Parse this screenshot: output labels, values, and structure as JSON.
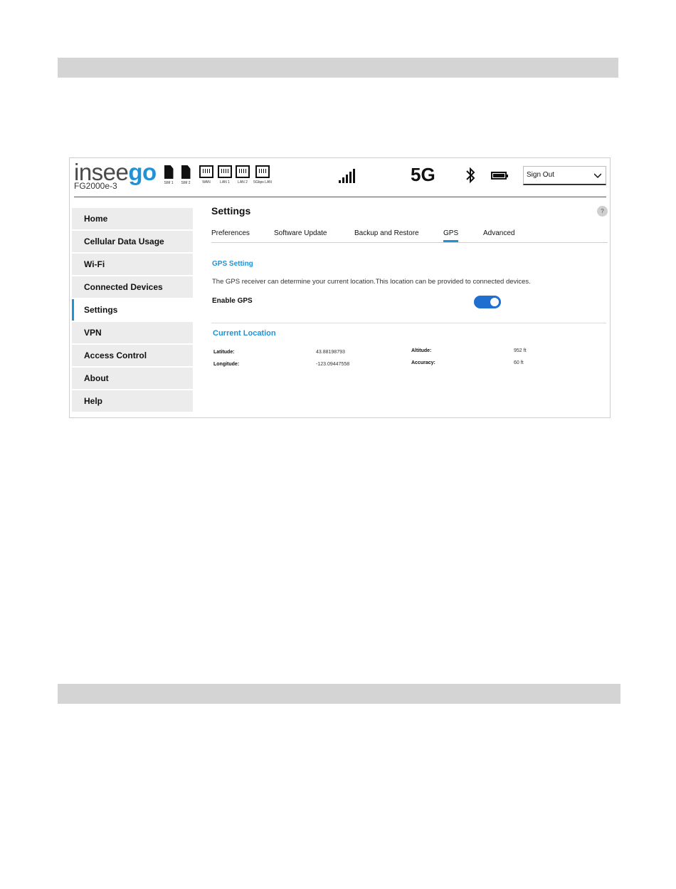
{
  "header": {
    "brand_part1": "insee",
    "brand_part2": "go",
    "model": "FG2000e-3",
    "sims": [
      {
        "label": "SIM 1"
      },
      {
        "label": "SIM 2"
      }
    ],
    "ports": [
      {
        "label": "WAN"
      },
      {
        "label": "LAN 1"
      },
      {
        "label": "LAN 2"
      },
      {
        "label": "5Gbps LAN"
      }
    ],
    "network": "5G",
    "signal_bars": 5,
    "signout_label": "Sign Out",
    "icons": [
      "signal-icon",
      "bluetooth-icon",
      "battery-icon",
      "chevron-down-icon"
    ]
  },
  "sidebar": {
    "items": [
      {
        "label": "Home",
        "active": false
      },
      {
        "label": "Cellular Data Usage",
        "active": false
      },
      {
        "label": "Wi-Fi",
        "active": false
      },
      {
        "label": "Connected Devices",
        "active": false
      },
      {
        "label": "Settings",
        "active": true
      },
      {
        "label": "VPN",
        "active": false
      },
      {
        "label": "Access Control",
        "active": false
      },
      {
        "label": "About",
        "active": false
      },
      {
        "label": "Help",
        "active": false
      }
    ]
  },
  "main": {
    "title": "Settings",
    "help_label": "?",
    "tabs": [
      {
        "label": "Preferences",
        "active": false
      },
      {
        "label": "Software Update",
        "active": false
      },
      {
        "label": "Backup and Restore",
        "active": false
      },
      {
        "label": "GPS",
        "active": true
      },
      {
        "label": "Advanced",
        "active": false
      }
    ],
    "gps_setting": {
      "title": "GPS Setting",
      "description": "The GPS receiver can determine your current location.This location can be provided to connected devices.",
      "enable_label": "Enable GPS",
      "enabled": true
    },
    "current_location": {
      "title": "Current Location",
      "latitude_label": "Latitude:",
      "latitude": "43.88198793",
      "longitude_label": "Longitude:",
      "longitude": "-123.09447558",
      "altitude_label": "Altitude:",
      "altitude": "952 ft",
      "accuracy_label": "Accuracy:",
      "accuracy": "60 ft"
    }
  },
  "colors": {
    "accent": "#1f93d6",
    "toggle_on": "#1f6fd0",
    "nav_bg": "#ececec",
    "doc_bar": "#d4d4d4"
  }
}
